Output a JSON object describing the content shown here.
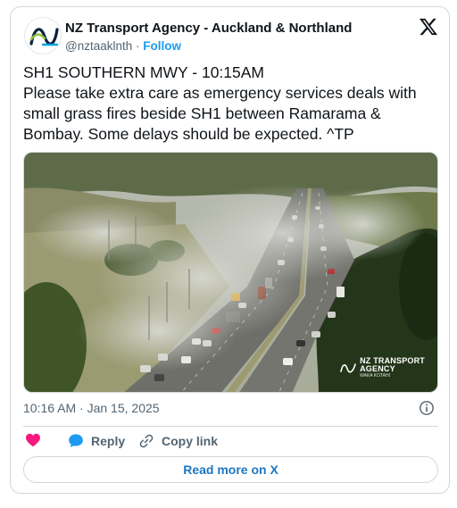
{
  "header": {
    "account_name": "NZ Transport Agency - Auckland & Northland",
    "handle": "@nztaaklnth",
    "separator": " · ",
    "follow_label": "Follow"
  },
  "tweet": {
    "lines": [
      "SH1 SOUTHERN MWY - 10:15AM",
      "Please take extra care as emergency services deals with",
      "small grass fires beside SH1 between Ramarama &",
      "Bombay. Some delays should be expected. ^TP"
    ]
  },
  "media": {
    "watermark_line1": "NZ TRANSPORT",
    "watermark_line2": "AGENCY",
    "watermark_line3": "WAKA KOTAHI"
  },
  "timestamp": "10:16 AM · Jan 15, 2025",
  "actions": {
    "like_label": "",
    "reply_label": "Reply",
    "copy_label": "Copy link"
  },
  "read_more_label": "Read more on X",
  "colors": {
    "accent_blue": "#1d9bf0",
    "like_pink": "#f91880",
    "text_gray": "#536471",
    "border": "#cfd9de"
  },
  "icons": [
    "agency-logo-icon",
    "x-logo-icon",
    "info-icon",
    "heart-icon",
    "reply-bubble-icon",
    "link-icon"
  ]
}
